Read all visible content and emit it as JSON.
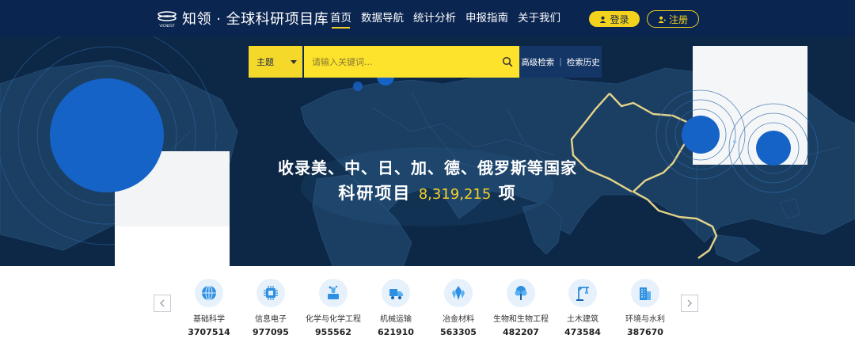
{
  "header": {
    "logo_text": "知领 · 全球科研项目库",
    "logo_mark_text": "VICNEST",
    "nav": [
      "首页",
      "数据导航",
      "统计分析",
      "申报指南",
      "关于我们"
    ],
    "login_label": "登录",
    "register_label": "注册"
  },
  "search": {
    "select_label": "主题",
    "placeholder": "请输入关键词...",
    "advanced_label": "高级检索",
    "separator": "|",
    "history_label": "检索历史"
  },
  "hero": {
    "line1": "收录美、中、日、加、德、俄罗斯等国家",
    "line2_prefix": "科研项目",
    "count": "8,319,215",
    "line2_suffix": "项"
  },
  "categories": [
    {
      "name": "基础科学",
      "count": "3707514",
      "icon": "globe-icon"
    },
    {
      "name": "信息电子",
      "count": "977095",
      "icon": "chip-icon"
    },
    {
      "name": "化学与化学工程",
      "count": "955562",
      "icon": "flask-icon"
    },
    {
      "name": "机械运输",
      "count": "621910",
      "icon": "truck-icon"
    },
    {
      "name": "冶金材料",
      "count": "563305",
      "icon": "crystal-icon"
    },
    {
      "name": "生物和生物工程",
      "count": "482207",
      "icon": "tree-icon"
    },
    {
      "name": "土木建筑",
      "count": "473584",
      "icon": "crane-icon"
    },
    {
      "name": "环境与水利",
      "count": "387670",
      "icon": "building-icon"
    }
  ],
  "colors": {
    "nav_bg": "#0a2550",
    "accent_yellow": "#f5d024",
    "hero_bg": "#0e2a4c",
    "circle_blue": "#1663c7"
  }
}
